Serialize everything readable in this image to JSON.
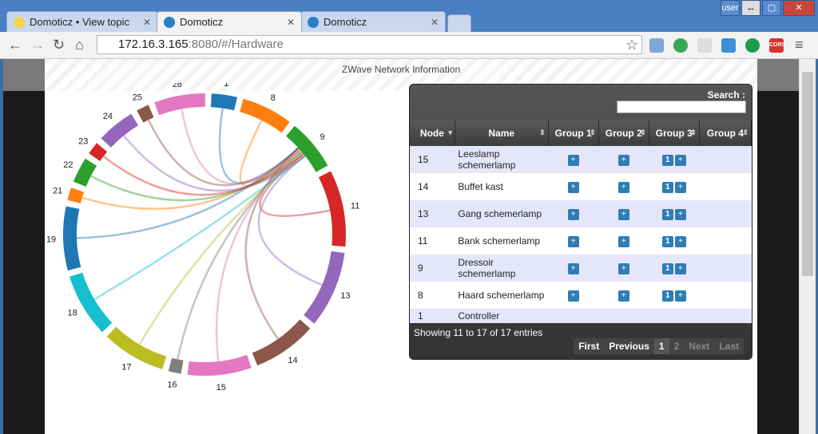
{
  "tabs": [
    {
      "label": "Domoticz • View topic"
    },
    {
      "label": "Domoticz"
    },
    {
      "label": "Domoticz"
    }
  ],
  "window_controls": [
    "user",
    "↔",
    "▢",
    "✕"
  ],
  "address": {
    "host": "172.16.3.165",
    "rest": ":8080/#/Hardware"
  },
  "extensions": [
    "mail-icon",
    "hangouts-icon",
    "grid-icon",
    "download-icon",
    "k-icon",
    "cors-icon"
  ],
  "extension_label_cors": "CORS",
  "heading": "ZWave Network Information",
  "chord": {
    "labels": [
      "1",
      "8",
      "9",
      "11",
      "13",
      "14",
      "15",
      "16",
      "17",
      "18",
      "19",
      "21",
      "22",
      "23",
      "24",
      "25",
      "26"
    ],
    "colors": [
      "#1f77b4",
      "#ff7f0e",
      "#2ca02c",
      "#d62728",
      "#9467bd",
      "#8c564b",
      "#e377c2",
      "#7f7f7f",
      "#bcbd22",
      "#17becf",
      "#1f77b4",
      "#ff7f0e",
      "#2ca02c",
      "#d62728",
      "#9467bd",
      "#8c564b",
      "#e377c2"
    ]
  },
  "table": {
    "search_label": "Search :",
    "headers": [
      "Node",
      "Name",
      "Group 1",
      "Group 2",
      "Group 3",
      "Group 4"
    ],
    "rows": [
      {
        "node": "15",
        "name": "Leeslamp schemerlamp",
        "g3num": "1"
      },
      {
        "node": "14",
        "name": "Buffet kast",
        "g3num": "1"
      },
      {
        "node": "13",
        "name": "Gang schemerlamp",
        "g3num": "1"
      },
      {
        "node": "11",
        "name": "Bank schemerlamp",
        "g3num": "1"
      },
      {
        "node": "9",
        "name": "Dressoir schemerlamp",
        "g3num": "1"
      },
      {
        "node": "8",
        "name": "Haard schemerlamp",
        "g3num": "1"
      },
      {
        "node": "1",
        "name": "Controller",
        "g3num": ""
      }
    ],
    "plus_label": "+",
    "showing": "Showing 11 to 17 of 17 entries",
    "pager": {
      "first": "First",
      "previous": "Previous",
      "page1": "1",
      "page2": "2",
      "next": "Next",
      "last": "Last"
    }
  }
}
